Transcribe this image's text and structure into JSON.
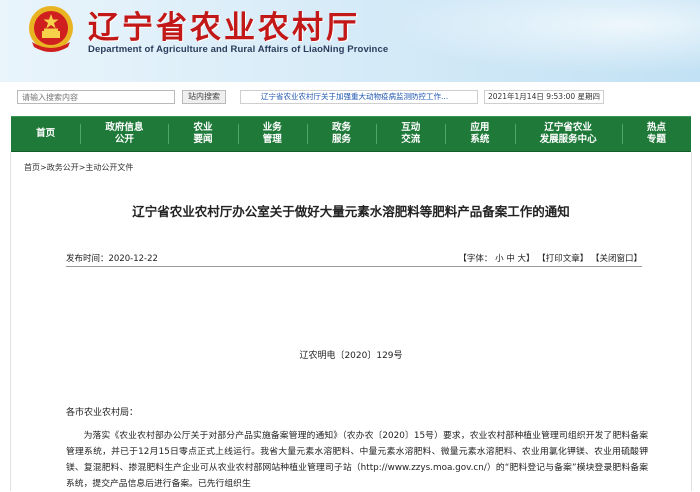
{
  "header": {
    "title": "辽宁省农业农村厅",
    "subtitle": "Department of Agriculture and Rural Affairs of LiaoNing Province",
    "emblem_icon": "national-emblem-icon",
    "title_color": "#c31818"
  },
  "searchbar": {
    "placeholder": "请输入搜索内容",
    "button_label": "站内搜索",
    "ticker_text": "辽宁省农业农村厅关于加强重大动物疫病监测防控工作...",
    "datetime": "2021年1月14日 9:53:00 星期四"
  },
  "nav": {
    "color": "#1f7a3a",
    "items": [
      {
        "line1": "首页",
        "line2": ""
      },
      {
        "line1": "政府信息",
        "line2": "公开"
      },
      {
        "line1": "农业",
        "line2": "要闻"
      },
      {
        "line1": "业务",
        "line2": "管理"
      },
      {
        "line1": "政务",
        "line2": "服务"
      },
      {
        "line1": "互动",
        "line2": "交流"
      },
      {
        "line1": "应用",
        "line2": "系统"
      },
      {
        "line1": "辽宁省农业",
        "line2": "发展服务中心"
      },
      {
        "line1": "热点",
        "line2": "专题"
      }
    ]
  },
  "breadcrumb": {
    "home": "首页",
    "sep": ">",
    "level1": "政务公开",
    "level2": "主动公开文件"
  },
  "article": {
    "title": "辽宁省农业农村厅办公室关于做好大量元素水溶肥料等肥料产品备案工作的通知",
    "publish_time": "发布时间：2020-12-22",
    "font_size_label": "【字体：",
    "font_small": "小",
    "font_medium": "中",
    "font_large": "大",
    "font_close": "】",
    "print_label": "【打印文章】",
    "close_label": "【关闭窗口】",
    "doc_number": "辽农明电〔2020〕129号",
    "salutation": "各市农业农村局：",
    "body": "为落实《农业农村部办公厅关于对部分产品实施备案管理的通知》（农办农〔2020〕15号）要求，农业农村部种植业管理司组织开发了肥料备案管理系统，并已于12月15日零点正式上线运行。我省大量元素水溶肥料、中量元素水溶肥料、微量元素水溶肥料、农业用氯化钾镁、农业用硫酸钾镁、复混肥料、掺混肥料生产企业可从农业农村部网站种植业管理司子站（http://www.zzys.moa.gov.cn/）的“肥料登记与备案”模块登录肥料备案系统，提交产品信息后进行备案。已先行组织生"
  }
}
